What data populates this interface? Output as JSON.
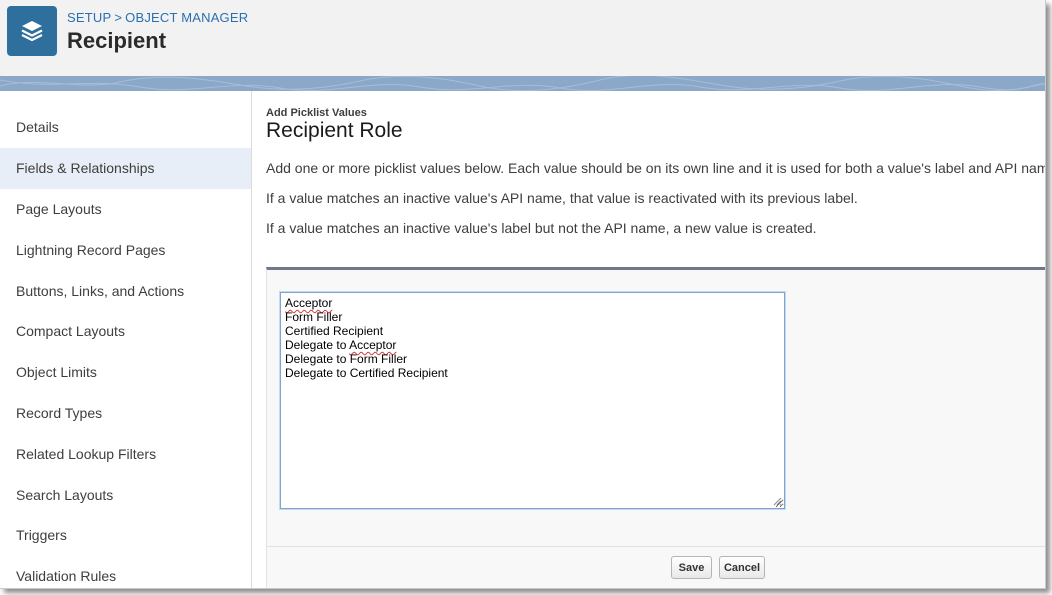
{
  "header": {
    "breadcrumb": [
      "SETUP",
      "OBJECT MANAGER"
    ],
    "breadcrumb_separator": ">",
    "title": "Recipient",
    "app_icon": "layers-icon"
  },
  "sidebar": {
    "active_index": 1,
    "items": [
      {
        "label": "Details"
      },
      {
        "label": "Fields & Relationships"
      },
      {
        "label": "Page Layouts"
      },
      {
        "label": "Lightning Record Pages"
      },
      {
        "label": "Buttons, Links, and Actions"
      },
      {
        "label": "Compact Layouts"
      },
      {
        "label": "Object Limits"
      },
      {
        "label": "Record Types"
      },
      {
        "label": "Related Lookup Filters"
      },
      {
        "label": "Search Layouts"
      },
      {
        "label": "Triggers"
      },
      {
        "label": "Validation Rules"
      }
    ]
  },
  "main": {
    "eyebrow": "Add Picklist Values",
    "title": "Recipient Role",
    "descriptions": [
      "Add one or more picklist values below. Each value should be on its own line and it is used for both a value's label and API name.",
      "If a value matches an inactive value's API name, that value is reactivated with its previous label.",
      "If a value matches an inactive value's label but not the API name, a new value is created."
    ],
    "picklist_values": [
      "Acceptor",
      "Form Filler",
      "Certified Recipient",
      "Delegate to Acceptor",
      "Delegate to Form Filler",
      "Delegate to Certified Recipient"
    ],
    "save_label": "Save",
    "cancel_label": "Cancel"
  },
  "colors": {
    "brand_icon": "#2f6f9e",
    "link": "#2a6fb0",
    "active_nav": "#e8eef7",
    "band": "#8ba8c9"
  }
}
